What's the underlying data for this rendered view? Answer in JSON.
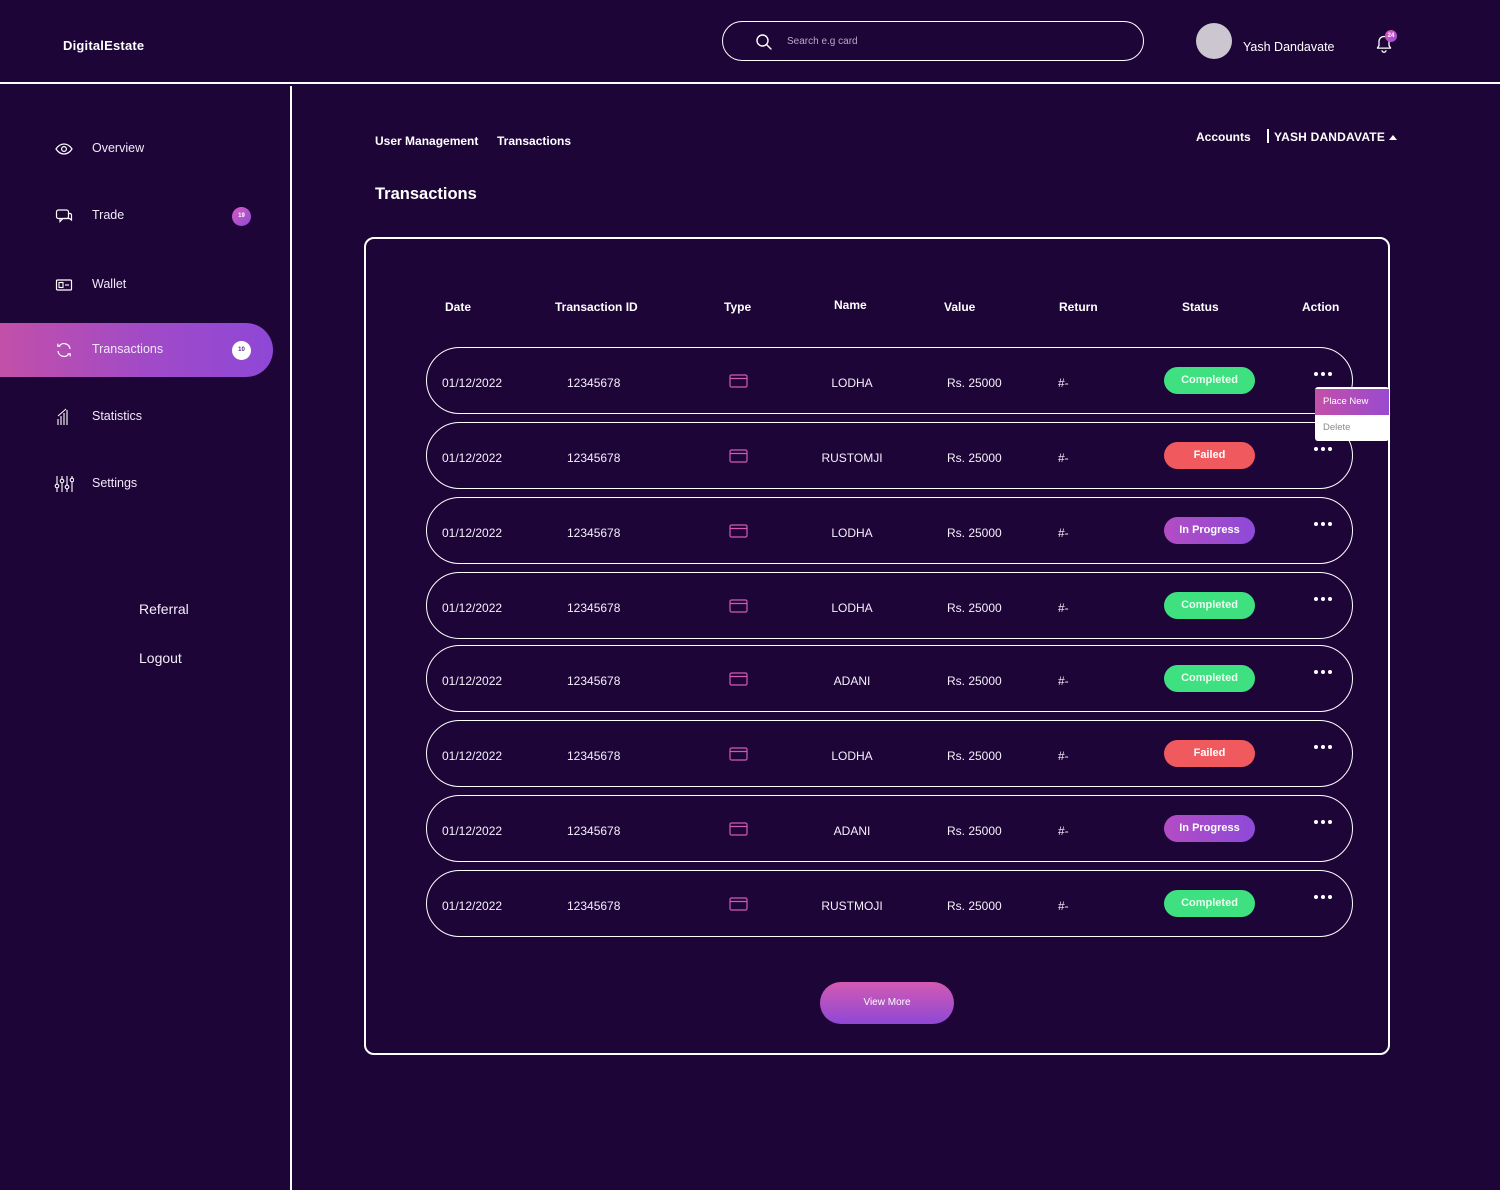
{
  "app": {
    "brand": "DigitalEstate"
  },
  "search": {
    "placeholder": "Search e.g card"
  },
  "user": {
    "name": "Yash Dandavate",
    "notifications": "24"
  },
  "sidebar": {
    "items": [
      {
        "label": "Overview",
        "icon": "eye-icon"
      },
      {
        "label": "Trade",
        "icon": "chat-icon",
        "badge": "19"
      },
      {
        "label": "Wallet",
        "icon": "wallet-icon"
      },
      {
        "label": "Transactions",
        "icon": "refresh-icon",
        "badge": "10",
        "active": true
      },
      {
        "label": "Statistics",
        "icon": "bar-chart-icon"
      },
      {
        "label": "Settings",
        "icon": "sliders-icon"
      }
    ],
    "links": {
      "referral": "Referral",
      "logout": "Logout"
    }
  },
  "breadcrumb": {
    "parent": "User Management",
    "current": "Transactions"
  },
  "accounts": {
    "label": "Accounts",
    "name": "YASH DANDAVATE"
  },
  "page": {
    "title": "Transactions"
  },
  "table": {
    "headers": {
      "date": "Date",
      "id": "Transaction ID",
      "type": "Type",
      "name": "Name",
      "value": "Value",
      "return": "Return",
      "status": "Status",
      "action": "Action"
    },
    "rows": [
      {
        "date": "01/12/2022",
        "id": "12345678",
        "name": "LODHA",
        "value": "Rs. 25000",
        "ret": "#-",
        "status": "Completed",
        "kind": "completed"
      },
      {
        "date": "01/12/2022",
        "id": "12345678",
        "name": "RUSTOMJI",
        "value": "Rs. 25000",
        "ret": "#-",
        "status": "Failed",
        "kind": "failed"
      },
      {
        "date": "01/12/2022",
        "id": "12345678",
        "name": "LODHA",
        "value": "Rs. 25000",
        "ret": "#-",
        "status": "In Progress",
        "kind": "progress"
      },
      {
        "date": "01/12/2022",
        "id": "12345678",
        "name": "LODHA",
        "value": "Rs. 25000",
        "ret": "#-",
        "status": "Completed",
        "kind": "completed"
      },
      {
        "date": "01/12/2022",
        "id": "12345678",
        "name": "ADANI",
        "value": "Rs. 25000",
        "ret": "#-",
        "status": "Completed",
        "kind": "completed"
      },
      {
        "date": "01/12/2022",
        "id": "12345678",
        "name": "LODHA",
        "value": "Rs. 25000",
        "ret": "#-",
        "status": "Failed",
        "kind": "failed"
      },
      {
        "date": "01/12/2022",
        "id": "12345678",
        "name": "ADANI",
        "value": "Rs. 25000",
        "ret": "#-",
        "status": "In Progress",
        "kind": "progress"
      },
      {
        "date": "01/12/2022",
        "id": "12345678",
        "name": "RUSTMOJI",
        "value": "Rs. 25000",
        "ret": "#-",
        "status": "Completed",
        "kind": "completed"
      }
    ]
  },
  "action_menu": {
    "place_new": "Place New",
    "delete": "Delete"
  },
  "view_more": "View More",
  "colors": {
    "background": "#1e0538",
    "completed": "#3ee07f",
    "failed": "#f05a5f",
    "progress": "#a04ac8",
    "accent": "#c250a8"
  }
}
